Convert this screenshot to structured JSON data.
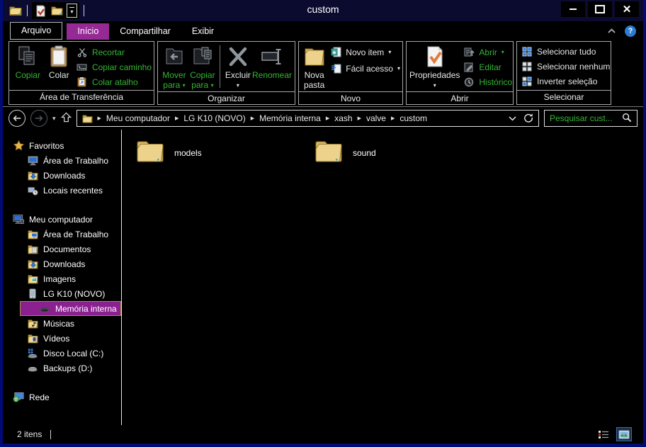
{
  "window": {
    "title": "custom"
  },
  "tabs": {
    "file": "Arquivo",
    "home": "Início",
    "share": "Compartilhar",
    "view": "Exibir"
  },
  "ribbon": {
    "clipboard": {
      "label": "Área de Transferência",
      "copy": "Copiar",
      "paste": "Colar",
      "cut": "Recortar",
      "copy_path": "Copiar caminho",
      "paste_shortcut": "Colar atalho"
    },
    "organize": {
      "label": "Organizar",
      "move_to": "Mover para",
      "copy_to": "Copiar para",
      "delete": "Excluir",
      "rename": "Renomear"
    },
    "new": {
      "label": "Novo",
      "new_folder": "Nova pasta",
      "new_item": "Novo item",
      "easy_access": "Fácil acesso"
    },
    "open": {
      "label": "Abrir",
      "properties": "Propriedades",
      "open": "Abrir",
      "edit": "Editar",
      "history": "Histórico"
    },
    "select": {
      "label": "Selecionar",
      "select_all": "Selecionar tudo",
      "select_none": "Selecionar nenhum",
      "invert": "Inverter seleção"
    }
  },
  "nav": {
    "breadcrumb": [
      "Meu computador",
      "LG K10 (NOVO)",
      "Memória interna",
      "xash",
      "valve",
      "custom"
    ],
    "search_placeholder": "Pesquisar cust..."
  },
  "sidebar": {
    "favorites": {
      "label": "Favoritos",
      "items": [
        "Área de Trabalho",
        "Downloads",
        "Locais recentes"
      ]
    },
    "computer": {
      "label": "Meu computador",
      "items": [
        "Área de Trabalho",
        "Documentos",
        "Downloads",
        "Imagens",
        "LG K10 (NOVO)",
        "Memória interna",
        "Músicas",
        "Vídeos",
        "Disco Local (C:)",
        "Backups (D:)"
      ],
      "selected_item": "Memória interna"
    },
    "network": {
      "label": "Rede"
    }
  },
  "content": {
    "files": [
      {
        "name": "models",
        "type": "folder"
      },
      {
        "name": "sound",
        "type": "folder"
      }
    ]
  },
  "status": {
    "count": "2 itens"
  },
  "icons": [
    "explorer-icon",
    "properties-qat-icon",
    "new-folder-qat-icon",
    "qat-dropdown-icon",
    "minimize-icon",
    "maximize-icon",
    "close-icon",
    "collapse-ribbon-icon",
    "help-icon",
    "copy-icon",
    "paste-icon",
    "cut-icon",
    "copy-path-icon",
    "paste-shortcut-icon",
    "move-to-icon",
    "copy-to-icon",
    "delete-icon",
    "rename-icon",
    "new-folder-icon",
    "new-item-icon",
    "easy-access-icon",
    "properties-icon",
    "open-icon",
    "edit-icon",
    "history-icon",
    "select-all-icon",
    "select-none-icon",
    "invert-selection-icon",
    "back-icon",
    "forward-icon",
    "up-icon",
    "refresh-icon",
    "chevron-down-icon",
    "search-icon",
    "star-icon",
    "desktop-icon",
    "downloads-icon",
    "recent-icon",
    "computer-icon",
    "documents-icon",
    "images-icon",
    "phone-icon",
    "drive-icon",
    "music-icon",
    "video-icon",
    "disk-c-icon",
    "backup-drive-icon",
    "network-icon",
    "folder-icon",
    "details-view-icon",
    "thumbnail-view-icon"
  ],
  "colors": {
    "accent_purple": "#952a95",
    "accent_green": "#35b535",
    "titlebar_navy": "#0b0b30",
    "window_border_blue": "#000a78",
    "folder_yellow": "#ecd28a"
  }
}
